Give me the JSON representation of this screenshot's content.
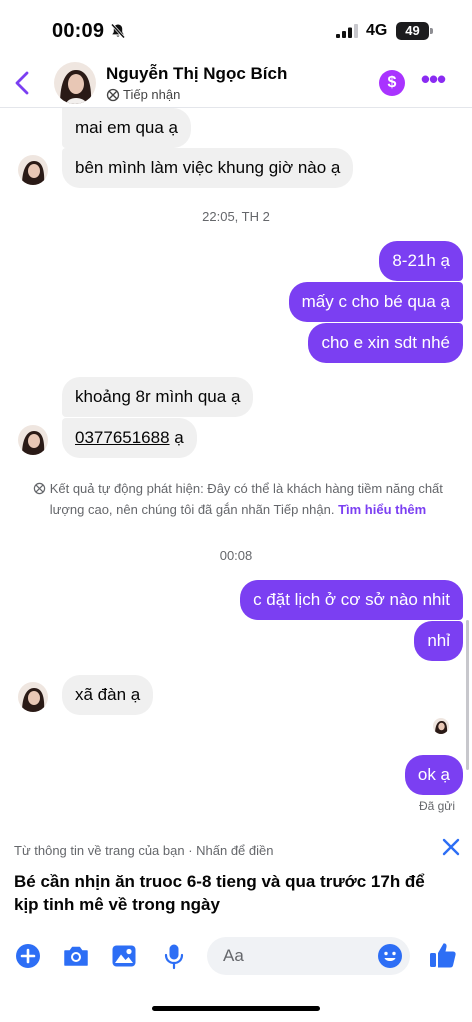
{
  "status_bar": {
    "time": "00:09",
    "network": "4G",
    "battery": "49"
  },
  "header": {
    "name": "Nguyễn Thị Ngọc Bích",
    "label": "Tiếp nhận"
  },
  "messages": [
    {
      "text": "mai em qua ạ"
    },
    {
      "text": "bên mình làm việc khung giờ nào ạ"
    },
    {
      "text": "8-21h ạ"
    },
    {
      "text": "mấy c cho bé qua ạ"
    },
    {
      "text": "cho e xin sdt nhé"
    },
    {
      "text": "khoảng 8r mình qua ạ"
    },
    {
      "text": "0377651688",
      "suffix": " ạ"
    },
    {
      "text": "c đặt lịch ở cơ sở nào nhit"
    },
    {
      "text": "nhỉ"
    },
    {
      "text": "xã đàn ạ"
    },
    {
      "text": "ok ạ"
    }
  ],
  "timestamps": [
    "22:05, TH 2",
    "00:08"
  ],
  "notice": {
    "text": "Kết quả tự động phát hiện: Đây có thể là khách hàng tiềm năng chất lượng cao, nên chúng tôi đã gắn nhãn Tiếp nhận.",
    "link": "Tìm hiểu thêm"
  },
  "sent_status": "Đã gửi",
  "suggestion": {
    "label": "Từ thông tin về trang của bạn · Nhấn để điền",
    "text": "Bé cần nhịn ăn truoc 6-8 tieng và qua trước 17h để kịp tinh mê về trong ngày"
  },
  "composer": {
    "placeholder": "Aa"
  },
  "colors": {
    "accent": "#7b3ff2",
    "incoming": "#f0f0f0",
    "link": "#2d6ef5",
    "dollar": "#a933ff"
  },
  "icons": [
    "back-icon",
    "bell-slash-icon",
    "dollar-icon",
    "more-icon",
    "lead-tag-icon",
    "close-icon",
    "plus-icon",
    "camera-icon",
    "image-icon",
    "microphone-icon",
    "emoji-icon",
    "thumbs-up-icon"
  ]
}
